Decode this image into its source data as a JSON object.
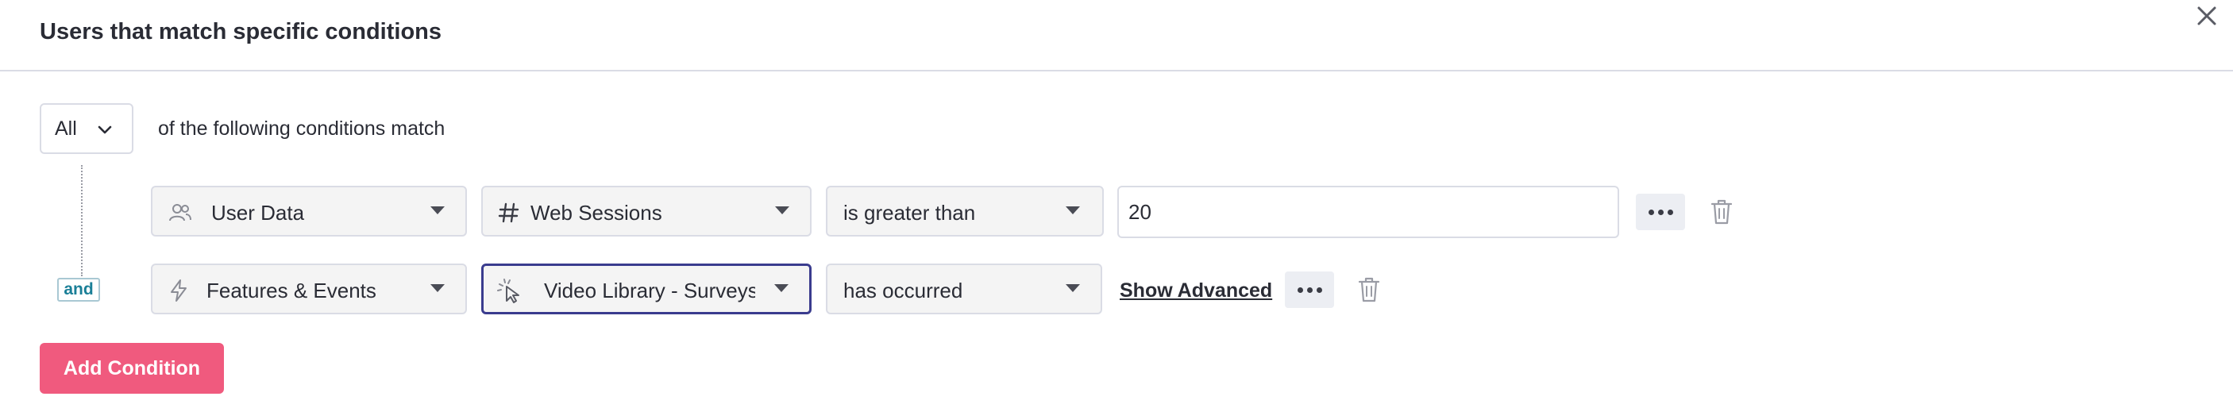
{
  "header": {
    "title": "Users that match specific conditions",
    "close_icon": "close-icon"
  },
  "logic": {
    "selected": "All",
    "caption": "of the following conditions match"
  },
  "connector": {
    "and_label": "and"
  },
  "conditions": [
    {
      "source": {
        "label": "User Data",
        "icon": "users-icon"
      },
      "field": {
        "label": "Web Sessions",
        "icon": "hash-icon"
      },
      "operator": {
        "label": "is greater than"
      },
      "value": "20",
      "more_icon": "more-icon",
      "delete_icon": "trash-icon"
    },
    {
      "source": {
        "label": "Features & Events",
        "icon": "lightning-icon"
      },
      "field": {
        "label": "Video Library - Surveys",
        "icon": "click-cursor-icon"
      },
      "operator": {
        "label": "has occurred"
      },
      "advanced_label": "Show Advanced",
      "more_icon": "more-icon",
      "delete_icon": "trash-icon"
    }
  ],
  "actions": {
    "add_condition_label": "Add Condition"
  },
  "colors": {
    "accent": "#f05a7e",
    "focus_border": "#3a3c8e",
    "and_text": "#1a7f97",
    "border": "#dadce5"
  }
}
